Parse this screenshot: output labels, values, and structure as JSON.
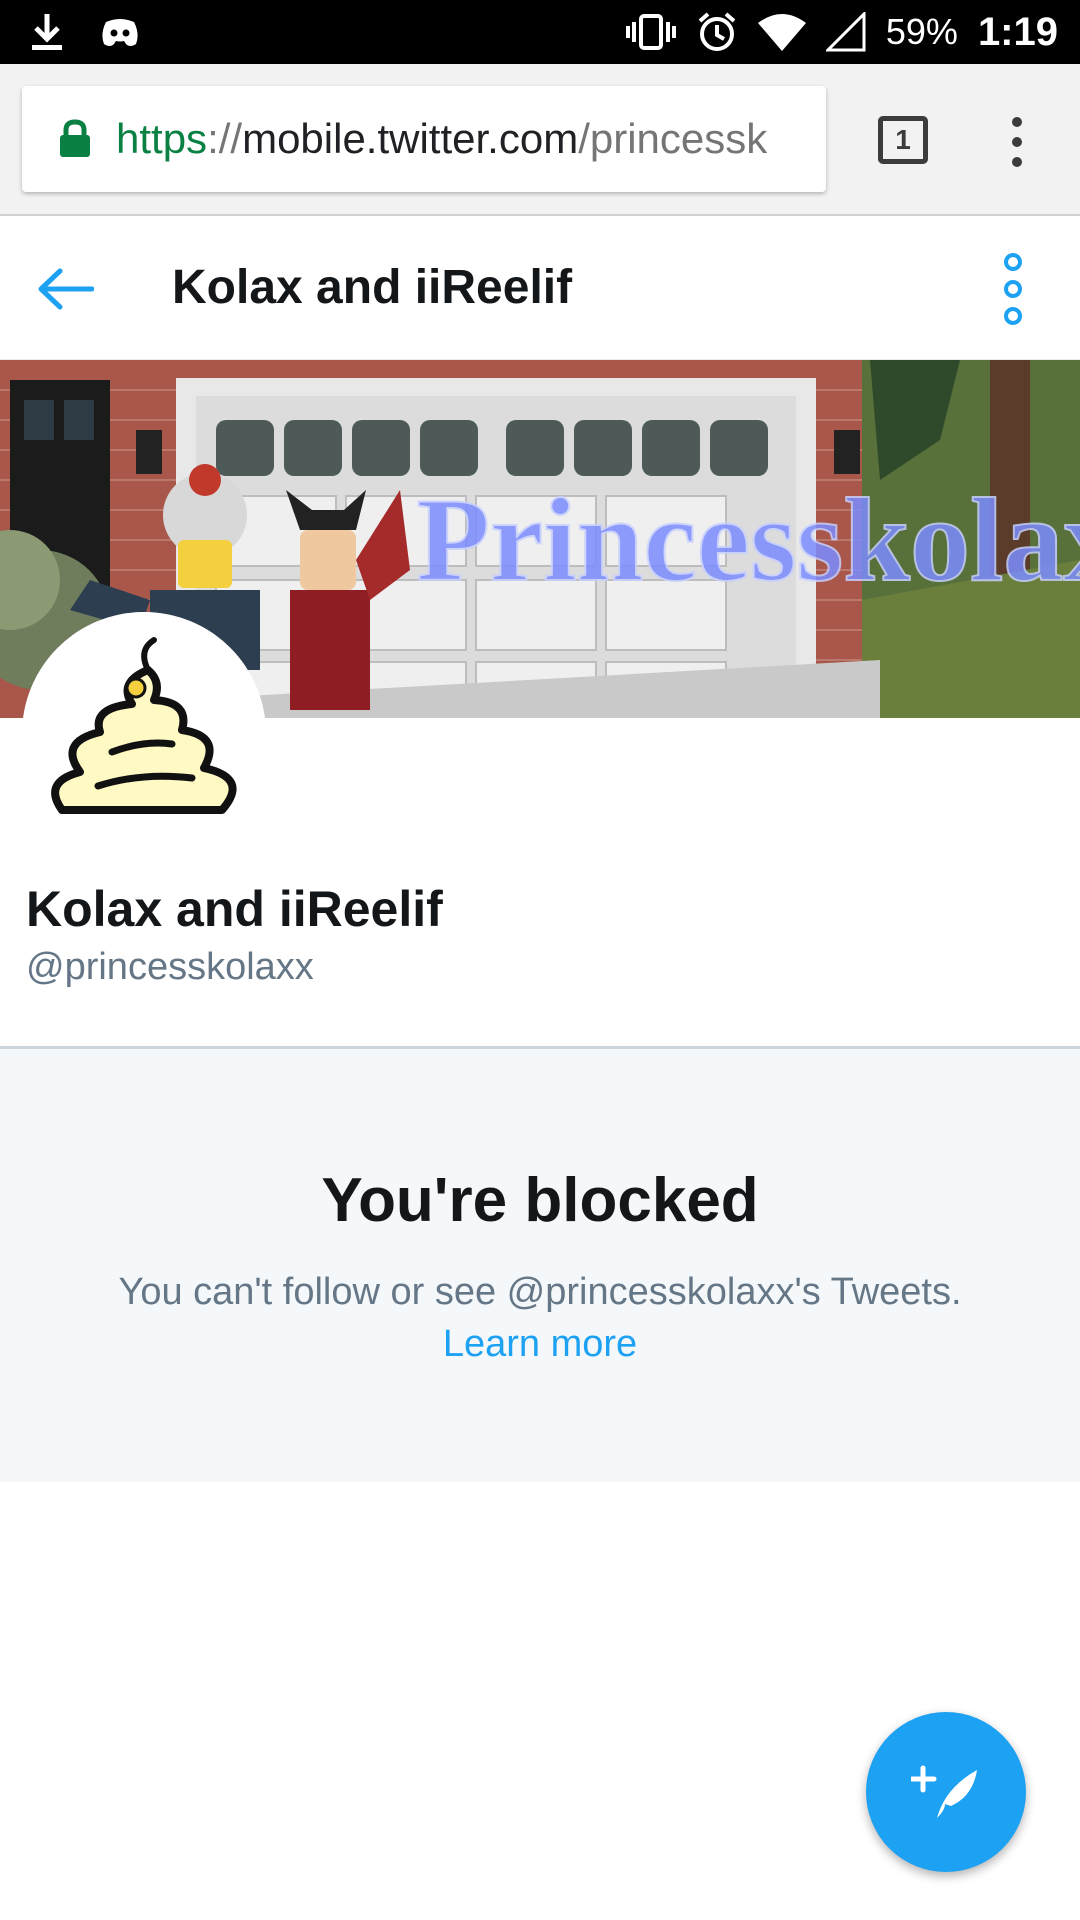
{
  "status_bar": {
    "battery": "59%",
    "time": "1:19",
    "icons": [
      "download-icon",
      "discord-icon",
      "vibrate-icon",
      "alarm-icon",
      "wifi-icon",
      "signal-icon"
    ]
  },
  "browser": {
    "url_scheme": "https",
    "url_sep": "://",
    "url_host": "mobile.twitter.com",
    "url_path": "/princessk",
    "tab_count": "1",
    "secure_color": "#0b8043"
  },
  "header": {
    "title": "Kolax and iiReelif"
  },
  "banner": {
    "overlay_text": "Princesskolax"
  },
  "profile": {
    "name": "Kolax and iiReelif",
    "handle": "@princesskolaxx"
  },
  "blocked": {
    "title": "You're blocked",
    "message": "You can't follow or see @princesskolaxx's Tweets.",
    "link": "Learn more"
  },
  "colors": {
    "accent": "#1da1f2",
    "text_primary": "#14171a",
    "text_secondary": "#657786",
    "panel_bg": "#f5f8fa"
  }
}
